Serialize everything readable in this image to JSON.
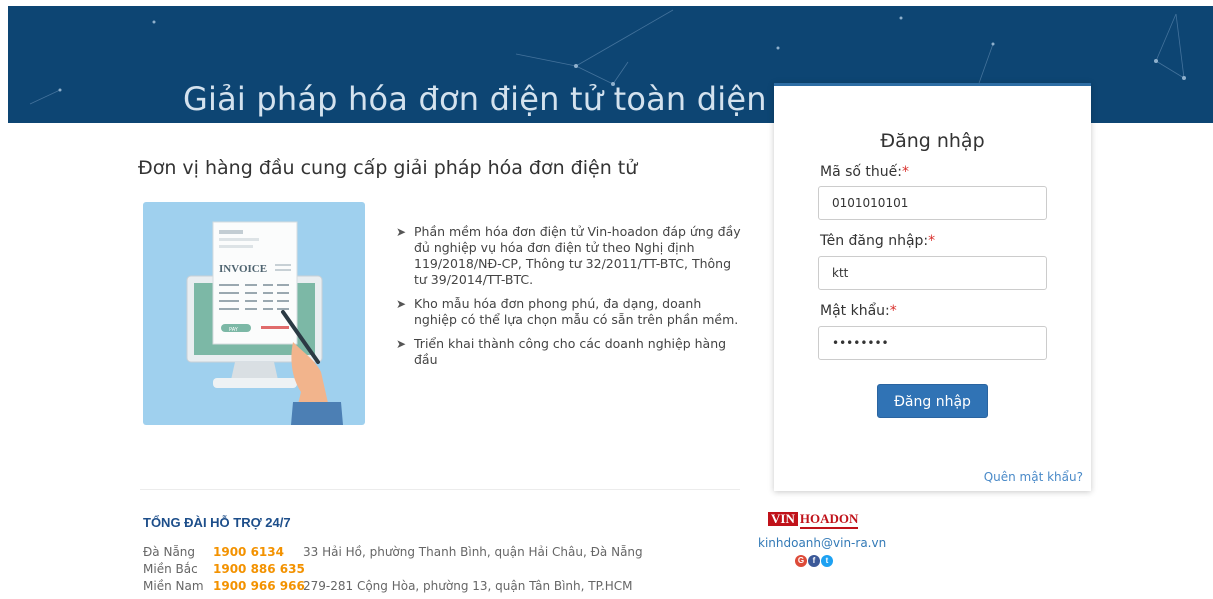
{
  "banner": {
    "title": "Giải pháp hóa đơn điện tử toàn diện"
  },
  "intro": {
    "headline": "Đơn vị hàng đầu cung cấp giải pháp hóa đơn điện tử",
    "illustration_label": "INVOICE",
    "illustration_button": "PAY",
    "features": [
      "Phần mềm hóa đơn điện tử Vin-hoadon đáp ứng đầy đủ nghiệp vụ hóa đơn điện tử theo Nghị định 119/2018/NĐ-CP, Thông tư 32/2011/TT-BTC, Thông tư 39/2014/TT-BTC.",
      "Kho mẫu hóa đơn phong phú, đa dạng, doanh nghiệp có thể lựa chọn mẫu có sẵn trên phần mềm.",
      "Triển khai thành công cho các doanh nghiệp hàng đầu"
    ]
  },
  "support": {
    "title": "TỔNG ĐÀI HỖ TRỢ 24/7",
    "contacts": [
      {
        "region": "Đà Nẵng",
        "phone": "1900 6134",
        "address": "33 Hải Hồ, phường Thanh Bình, quận Hải Châu, Đà Nẵng"
      },
      {
        "region": "Miền Bắc",
        "phone": "1900 886 635",
        "address": ""
      },
      {
        "region": "Miền Nam",
        "phone": "1900 966 966",
        "address": "279-281 Cộng Hòa, phường 13, quận Tân Bình, TP.HCM"
      }
    ]
  },
  "brand": {
    "logo_vin": "VIN",
    "logo_hoadon": "HOADON",
    "email": "kinhdoanh@vin-ra.vn",
    "social": [
      {
        "icon": "google-plus-icon",
        "glyph": "G"
      },
      {
        "icon": "facebook-icon",
        "glyph": "f"
      },
      {
        "icon": "twitter-icon",
        "glyph": "t"
      }
    ]
  },
  "login": {
    "title": "Đăng nhập",
    "tax_code_label": "Mã số thuế:",
    "tax_code_value": "0101010101",
    "username_label": "Tên đăng nhập:",
    "username_value": "ktt",
    "password_label": "Mật khẩu:",
    "password_value": "••••••••",
    "required_mark": "*",
    "submit_label": "Đăng nhập",
    "forgot_label": "Quên mật khẩu?"
  },
  "colors": {
    "banner_bg": "#0d4573",
    "accent": "#3073b5",
    "phone": "#f39200",
    "required": "#d9302c",
    "brand_red": "#c0121a"
  }
}
